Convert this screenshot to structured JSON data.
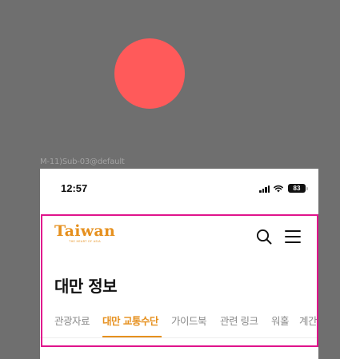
{
  "frame": {
    "label": "M-11)Sub-03@default"
  },
  "status_bar": {
    "time": "12:57",
    "battery": "83"
  },
  "header": {
    "logo_text": "Taiwan",
    "logo_tagline": "THE HEART OF ASIA"
  },
  "page": {
    "title": "대만 정보"
  },
  "tabs": [
    {
      "label": "관광자료",
      "active": false
    },
    {
      "label": "대만 교통수단",
      "active": true
    },
    {
      "label": "가이드북",
      "active": false
    },
    {
      "label": "관련 링크",
      "active": false
    },
    {
      "label": "워홀",
      "active": false
    },
    {
      "label": "계간",
      "active": false
    }
  ],
  "colors": {
    "accent": "#e6901e",
    "highlight": "#e0148c",
    "record": "#ff5a5a",
    "backdrop": "#6f6f6f"
  }
}
